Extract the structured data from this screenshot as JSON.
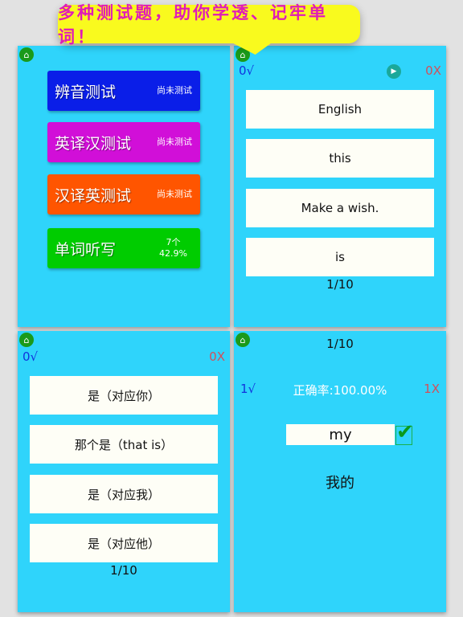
{
  "banner": {
    "text": "多种测试题，助你学透、记牢单词！"
  },
  "menu": {
    "items": [
      {
        "label": "辨音测试",
        "status": "尚未测试",
        "color": "#0a1ee8"
      },
      {
        "label": "英译汉测试",
        "status": "尚未测试",
        "color": "#d10fd8"
      },
      {
        "label": "汉译英测试",
        "status": "尚未测试",
        "color": "#ff5500"
      },
      {
        "label": "单词听写",
        "status": "7个",
        "status2": "42.9%",
        "color": "#00cc00"
      }
    ]
  },
  "quiz1": {
    "correct": "0√",
    "wrong": "0X",
    "options": [
      "English",
      "this",
      "Make a wish.",
      "is"
    ],
    "progress": "1/10"
  },
  "quiz2": {
    "correct": "0√",
    "wrong": "0X",
    "options": [
      "是（对应你）",
      "那个是（that is）",
      "是（对应我）",
      "是（对应他）"
    ],
    "progress": "1/10"
  },
  "dictation": {
    "progress": "1/10",
    "correct": "1√",
    "accuracy": "正确率:100.00%",
    "wrong": "1X",
    "input": "my",
    "meaning": "我的"
  }
}
